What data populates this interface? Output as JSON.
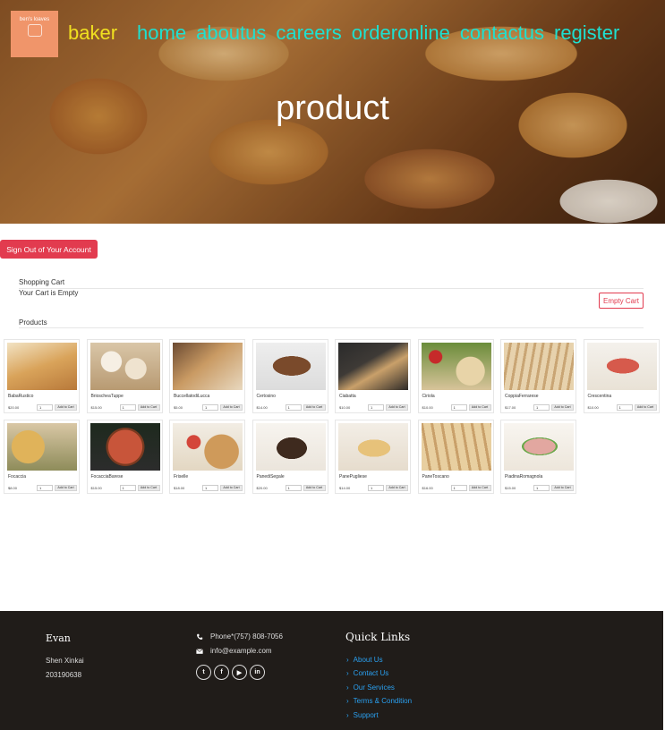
{
  "header": {
    "logo_text": "ben's loaves",
    "brand": "baker",
    "nav": [
      {
        "label": "home"
      },
      {
        "label": "aboutus"
      },
      {
        "label": "careers"
      },
      {
        "label": "orderonline"
      },
      {
        "label": "contactus"
      },
      {
        "label": "register"
      }
    ],
    "page_title": "product"
  },
  "account": {
    "sign_out_label": "Sign Out of Your Account"
  },
  "cart": {
    "heading": "Shopping Cart",
    "status": "Your Cart is Empty",
    "empty_button": "Empty Cart"
  },
  "products_heading": "Products",
  "product_add_label": "Add to Cart",
  "products": [
    {
      "name": "BabaRustico",
      "price": "$20.00",
      "qty": "1"
    },
    {
      "name": "BrioscheaTuppe",
      "price": "$15.00",
      "qty": "1"
    },
    {
      "name": "BuccellatodiLucca",
      "price": "$5.00",
      "qty": "1"
    },
    {
      "name": "Certosino",
      "price": "$14.00",
      "qty": "1"
    },
    {
      "name": "Ciabatta",
      "price": "$10.00",
      "qty": "1"
    },
    {
      "name": "Ciriola",
      "price": "$10.00",
      "qty": "1"
    },
    {
      "name": "CoppiaFerrarese",
      "price": "$17.00",
      "qty": "1"
    },
    {
      "name": "Crescentina",
      "price": "$10.00",
      "qty": "1"
    },
    {
      "name": "Focaccia",
      "price": "$8.00",
      "qty": "1"
    },
    {
      "name": "FocacciaBarese",
      "price": "$15.00",
      "qty": "1"
    },
    {
      "name": "Friselle",
      "price": "$18.00",
      "qty": "1"
    },
    {
      "name": "PanediSegale",
      "price": "$20.00",
      "qty": "1"
    },
    {
      "name": "PanePugliese",
      "price": "$14.00",
      "qty": "1"
    },
    {
      "name": "PaneToscano",
      "price": "$16.00",
      "qty": "1"
    },
    {
      "name": "PiadinaRomagnola",
      "price": "$15.00",
      "qty": "1"
    }
  ],
  "footer": {
    "name": "Evan",
    "line1": "Shen Xinkai",
    "line2": "203190638",
    "phone": "Phone*(757) 808-7056",
    "email": "info@example.com",
    "socials": [
      {
        "icon": "twitter-icon",
        "glyph": "t"
      },
      {
        "icon": "facebook-icon",
        "glyph": "f"
      },
      {
        "icon": "youtube-icon",
        "glyph": "▶"
      },
      {
        "icon": "linkedin-icon",
        "glyph": "in"
      }
    ],
    "quick_links_title": "Quick Links",
    "quick_links": [
      {
        "label": "About Us"
      },
      {
        "label": "Contact Us"
      },
      {
        "label": "Our Services"
      },
      {
        "label": "Terms & Condition"
      },
      {
        "label": "Support"
      }
    ]
  },
  "colors": {
    "brand": "#f0e020",
    "nav_link": "#1ee0d0",
    "danger": "#e23b4f",
    "footer_bg": "#201c19",
    "footer_link": "#2aa0f0"
  }
}
